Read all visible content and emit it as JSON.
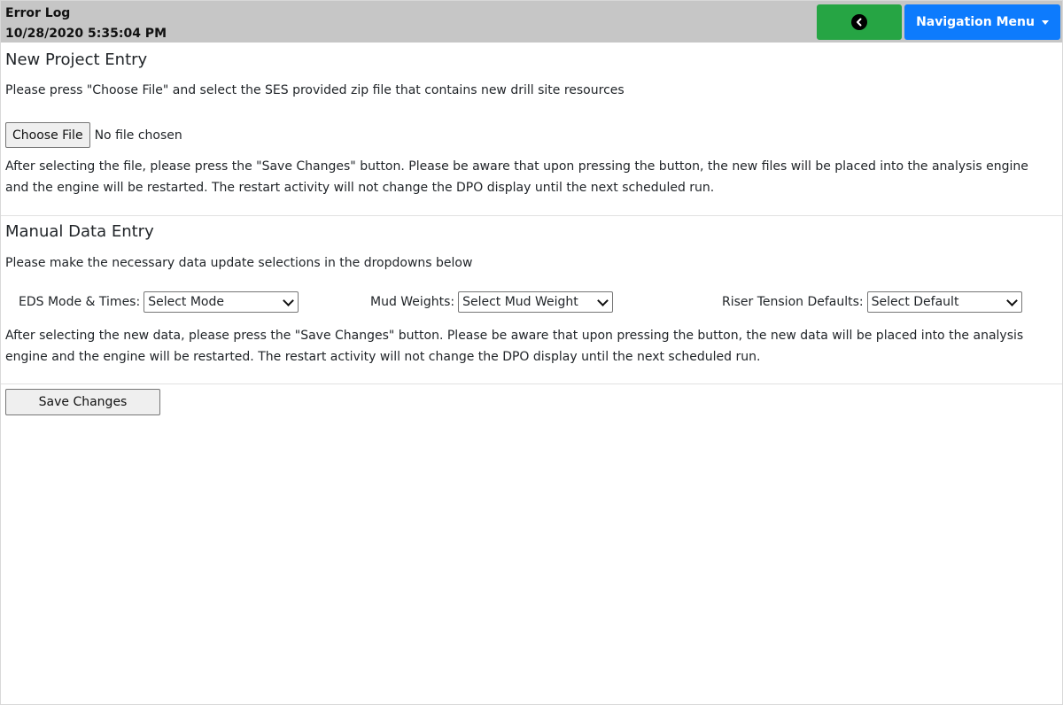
{
  "header": {
    "title": "Error Log",
    "timestamp": "10/28/2020 5:35:04 PM",
    "back_icon": "chevron-left-circle-icon",
    "nav_menu_label": "Navigation Menu",
    "colors": {
      "bar": "#c6c6c6",
      "back_button": "#26a544",
      "nav_button": "#0d7bfd"
    }
  },
  "new_project": {
    "title": "New Project Entry",
    "intro": "Please press \"Choose File\" and select the SES provided zip file that contains new drill site resources",
    "choose_file_label": "Choose File",
    "file_status": "No file chosen",
    "after_text": "After selecting the file, please press the \"Save Changes\" button. Please be aware that upon pressing the button, the new files will be placed into the analysis engine and the engine will be restarted. The restart activity will not change the DPO display until the next scheduled run."
  },
  "manual_entry": {
    "title": "Manual Data Entry",
    "intro": "Please make the necessary data update selections in the dropdowns below",
    "eds_label": "EDS Mode & Times:",
    "eds_value": "Select Mode",
    "mud_label": "Mud Weights:",
    "mud_value": "Select Mud Weight",
    "riser_label": "Riser Tension Defaults:",
    "riser_value": "Select Default",
    "after_text": "After selecting the new data, please press the \"Save Changes\" button. Please be aware that upon pressing the button, the new data will be placed into the analysis engine and the engine will be restarted. The restart activity will not change the DPO display until the next scheduled run."
  },
  "save_label": "Save Changes"
}
